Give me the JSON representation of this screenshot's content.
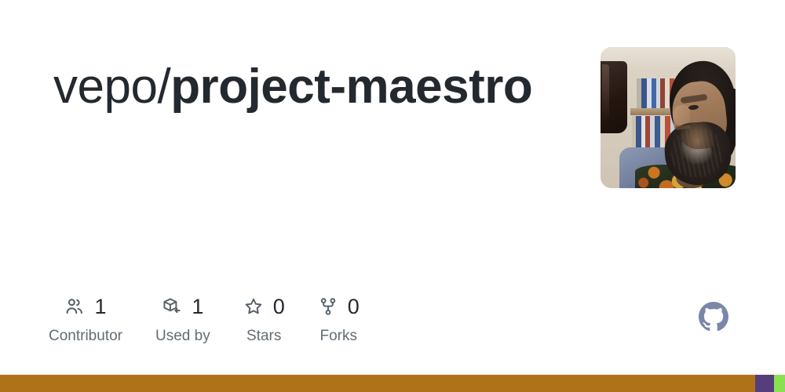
{
  "repo": {
    "owner": "vepo",
    "separator": "/",
    "name": "project-maestro",
    "full_name": "vepo/project-maestro"
  },
  "avatar": {
    "alt": "owner avatar photo",
    "description": "Bearded person in patterned shirt in front of a bookshelf"
  },
  "stats": [
    {
      "icon": "people-icon",
      "value": "1",
      "label": "Contributor"
    },
    {
      "icon": "package-used-by-icon",
      "value": "1",
      "label": "Used by"
    },
    {
      "icon": "star-icon",
      "value": "0",
      "label": "Stars"
    },
    {
      "icon": "fork-icon",
      "value": "0",
      "label": "Forks"
    }
  ],
  "brand": {
    "icon": "github-mark-icon",
    "color": "#7a87a8"
  },
  "language_bar": [
    {
      "color": "#b07219",
      "width_pct": 96.2
    },
    {
      "color": "#563d7c",
      "width_pct": 2.4
    },
    {
      "color": "#89e051",
      "width_pct": 1.4
    }
  ],
  "colors": {
    "background": "#ffffff",
    "title": "#24292f",
    "stat_value": "#24292f",
    "stat_label": "#636c76",
    "icon": "#57606a"
  }
}
